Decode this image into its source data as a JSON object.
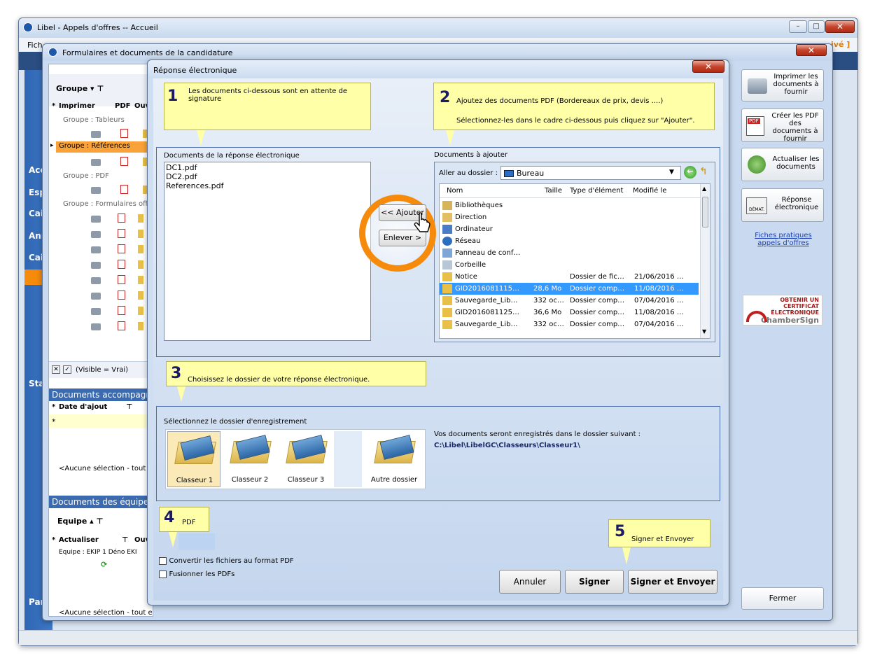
{
  "main_window": {
    "title": "Libel - Appels d'offres -- Accueil",
    "menu_fragment": "Fich",
    "right_fragment": "ivé ]"
  },
  "left_nav": {
    "items": [
      "Acc",
      "Esp",
      "Cai",
      "Ann",
      "Cai",
      "Sta",
      "Par"
    ]
  },
  "form_window": {
    "title": "Formulaires et documents de la candidature",
    "group_header": "Groupe",
    "col_imprimer": "Imprimer",
    "col_pdf": "PDF",
    "col_ouv": "Ouv",
    "groups": [
      "Groupe : Tableurs",
      "Groupe : Références",
      "Groupe : PDF",
      "Groupe : Formulaires offi"
    ],
    "filter_text": "(Visible = Vrai)",
    "docs_accomp_title": "Documents accompagn",
    "col_date_ajout": "Date d'ajout",
    "no_selection": "<Aucune sélection - tout e",
    "docs_equipe_title": "Documents des équipe",
    "equipe_header": "Equipe",
    "col_actualiser": "Actualiser",
    "col_ouv2": "Ouv",
    "equipe_row": "Equipe : EKIP 1 Déno EKI",
    "no_selection2": "<Aucune sélection - tout e"
  },
  "right_panel": {
    "buttons": [
      {
        "label": "Imprimer les documents à fournir",
        "icon": "printer-icon"
      },
      {
        "label": "Créer les PDF des documents à fournir",
        "icon": "pdf-create-icon"
      },
      {
        "label": "Actualiser les documents",
        "icon": "refresh-icon"
      },
      {
        "label": "Réponse électronique",
        "icon": "demat-icon"
      }
    ],
    "link": "Fiches pratiques appels d'offres",
    "cert_line1": "OBTENIR UN CERTIFICAT",
    "cert_line2": "ÉLECTRONIQUE",
    "cert_brand": "ChamberSign",
    "close_label": "Fermer"
  },
  "dialog": {
    "title": "Réponse électronique",
    "note1": {
      "num": "1",
      "text": "Les documents ci-dessous sont en attente de signature"
    },
    "note2": {
      "num": "2",
      "line1": "Ajoutez des documents PDF (Bordereaux de prix, devis ....)",
      "line2": "Sélectionnez-les dans le cadre  ci-dessous puis cliquez sur \"Ajouter\"."
    },
    "note3": {
      "num": "3",
      "text": "Choisissez le dossier de votre réponse électronique."
    },
    "note4": {
      "num": "4",
      "text": "PDF"
    },
    "note5": {
      "num": "5",
      "text": "Signer et Envoyer"
    },
    "docs_response_label": "Documents de la réponse électronique",
    "docs_response": [
      "DC1.pdf",
      "DC2.pdf",
      "References.pdf"
    ],
    "add_button": "<< Ajouter",
    "remove_button": "Enlever >",
    "docs_to_add_label": "Documents à ajouter",
    "goto_folder_label": "Aller au dossier :",
    "goto_folder_value": "Bureau",
    "file_columns": [
      "Nom",
      "Taille",
      "Type d'élément",
      "Modifié le"
    ],
    "files": [
      {
        "name": "Bibliothèques",
        "size": "",
        "type": "",
        "date": "",
        "icon": "library-icon"
      },
      {
        "name": "Direction",
        "size": "",
        "type": "",
        "date": "",
        "icon": "user-folder-icon"
      },
      {
        "name": "Ordinateur",
        "size": "",
        "type": "",
        "date": "",
        "icon": "computer-icon"
      },
      {
        "name": "Réseau",
        "size": "",
        "type": "",
        "date": "",
        "icon": "network-icon"
      },
      {
        "name": "Panneau de conf…",
        "size": "",
        "type": "",
        "date": "",
        "icon": "control-panel-icon"
      },
      {
        "name": "Corbeille",
        "size": "",
        "type": "",
        "date": "",
        "icon": "recycle-bin-icon"
      },
      {
        "name": "Notice",
        "size": "",
        "type": "Dossier de fic…",
        "date": "21/06/2016 …",
        "icon": "folder-icon"
      },
      {
        "name": "GID2016081115…",
        "size": "28,6 Mo",
        "type": "Dossier comp…",
        "date": "11/08/2016 …",
        "icon": "zip-folder-icon",
        "selected": true
      },
      {
        "name": "Sauvegarde_Lib…",
        "size": "332 oc…",
        "type": "Dossier comp…",
        "date": "07/04/2016 …",
        "icon": "zip-folder-icon"
      },
      {
        "name": "GID2016081125…",
        "size": "36,6 Mo",
        "type": "Dossier comp…",
        "date": "11/08/2016 …",
        "icon": "zip-folder-icon"
      },
      {
        "name": "Sauvegarde_Lib…",
        "size": "332 oc…",
        "type": "Dossier comp…",
        "date": "07/04/2016 …",
        "icon": "zip-folder-icon"
      }
    ],
    "select_folder_label": "Sélectionnez le dossier d'enregistrement",
    "folders": [
      "Classeur 1",
      "Classeur 2",
      "Classeur 3",
      "Autre dossier"
    ],
    "save_info": "Vos documents seront enregistrés dans le dossier suivant :",
    "save_path": "C:\\Libel\\LibelGC\\Classeurs\\Classeur1\\",
    "convert_pdf": "Convertir les fichiers au format PDF",
    "merge_pdf": "Fusionner les PDFs",
    "cancel_button": "Annuler",
    "sign_button": "Signer",
    "sign_send_button": "Signer et Envoyer"
  },
  "colors": {
    "accent_orange": "#f58a0b",
    "note_yellow": "#ffffa8",
    "selection_blue": "#3399ff",
    "nav_blue": "#2d63b3"
  }
}
